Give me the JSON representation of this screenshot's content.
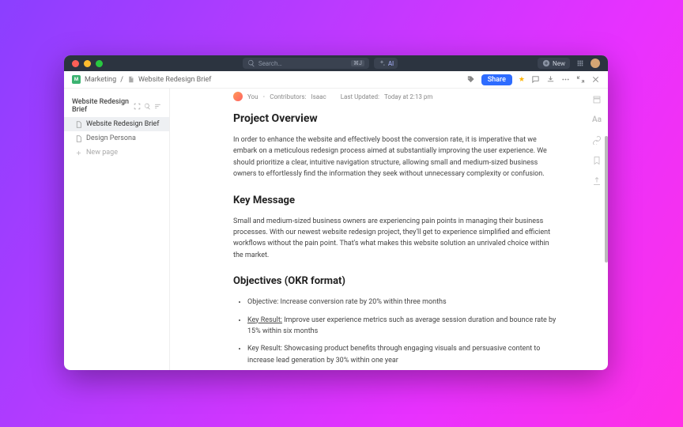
{
  "titlebar": {
    "search_placeholder": "Search…",
    "search_shortcut": "⌘J",
    "ai_label": "AI",
    "new_label": "New"
  },
  "breadcrumb": {
    "workspace_initial": "M",
    "workspace": "Marketing",
    "separator": "/",
    "page": "Website Redesign Brief",
    "share": "Share"
  },
  "sidebar": {
    "title": "Website Redesign Brief",
    "items": [
      {
        "label": "Website Redesign Brief"
      },
      {
        "label": "Design Persona"
      }
    ],
    "new_page": "New page"
  },
  "meta": {
    "you": "You",
    "contributors_label": "Contributors:",
    "contributors": "Isaac",
    "updated_label": "Last Updated:",
    "updated_value": "Today at 2:13 pm"
  },
  "doc": {
    "h_overview": "Project Overview",
    "p_overview": "In order to enhance the website and effectively boost the conversion rate, it is imperative that we embark on a meticulous redesign process aimed at substantially improving the user experience. We should prioritize a clear, intuitive navigation structure, allowing small and medium-sized business owners to effortlessly find the information they seek without unnecessary complexity or confusion.",
    "h_key": "Key Message",
    "p_key": "Small and medium-sized business owners are experiencing pain points in managing their business processes. With our newest website redesign project, they'll get to experience simplified and efficient workflows without the pain point. That's what makes this website solution an unrivaled choice within the market.",
    "h_obj": "Objectives (OKR format)",
    "li1": "Objective: Increase conversion rate by 20% within three months",
    "li2a": "Key Result:",
    "li2b": " Improve user experience metrics such as average session duration and bounce rate by 15% within six months",
    "li3": "Key Result: Showcasing product benefits through engaging visuals and persuasive content to increase lead generation by 30% within one year"
  },
  "rail": {
    "aa": "Aa"
  }
}
